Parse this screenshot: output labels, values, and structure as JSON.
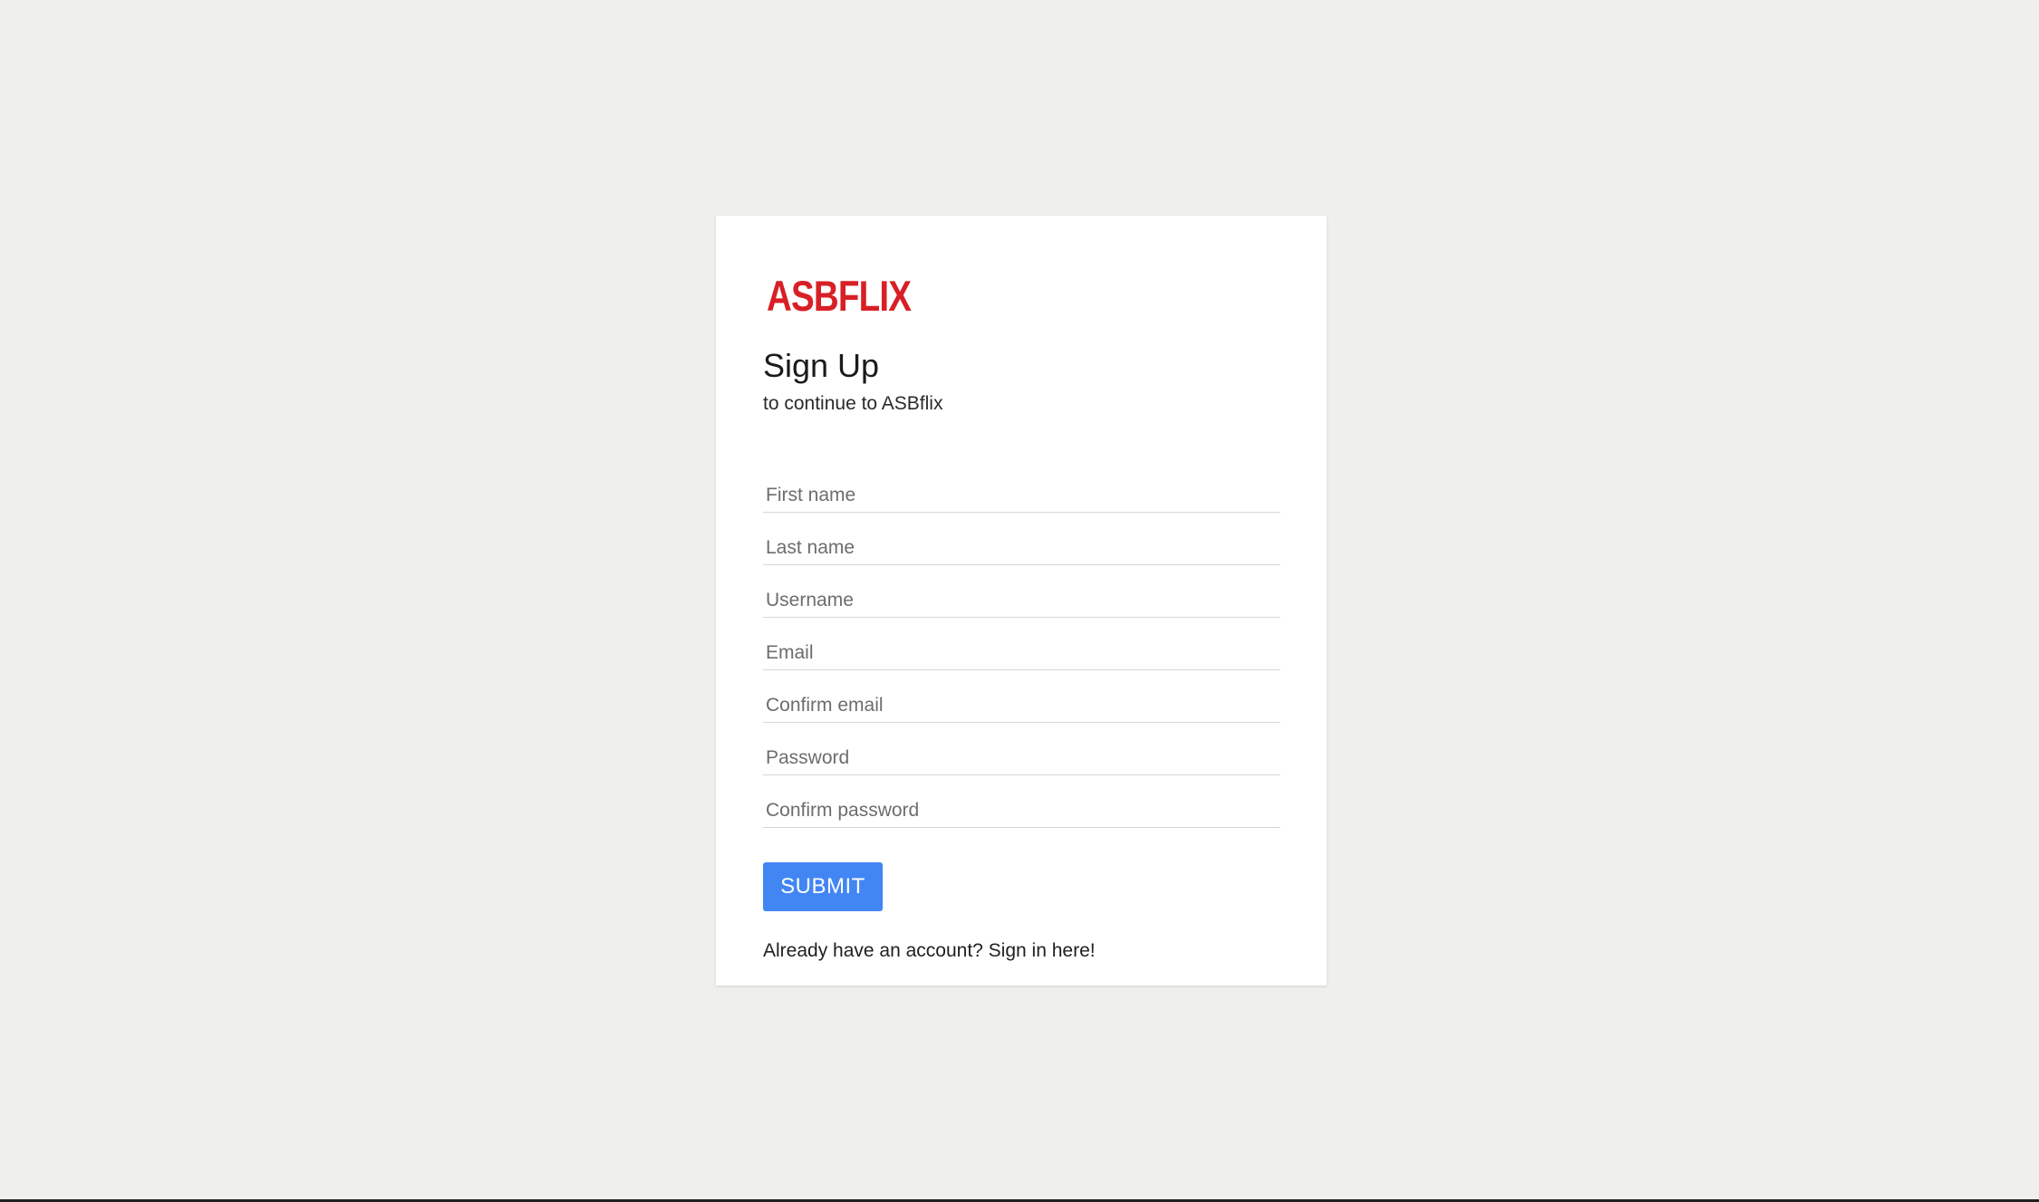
{
  "brand": {
    "logo_text": "ASBFLIX",
    "logo_color": "#d81f26"
  },
  "page": {
    "title": "Sign Up",
    "subtitle": "to continue to ASBflix"
  },
  "form": {
    "fields": [
      {
        "placeholder": "First name",
        "value": ""
      },
      {
        "placeholder": "Last name",
        "value": ""
      },
      {
        "placeholder": "Username",
        "value": ""
      },
      {
        "placeholder": "Email",
        "value": ""
      },
      {
        "placeholder": "Confirm email",
        "value": ""
      },
      {
        "placeholder": "Password",
        "value": ""
      },
      {
        "placeholder": "Confirm password",
        "value": ""
      }
    ],
    "submit_label": "SUBMIT",
    "submit_color": "#4286f4"
  },
  "footer": {
    "prompt": "Already have an account? ",
    "signin_link": "Sign in here!"
  }
}
